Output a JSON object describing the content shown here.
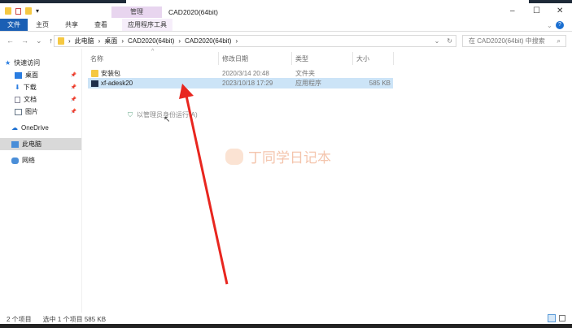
{
  "window": {
    "title": "CAD2020(64bit)",
    "context_tab": "管理",
    "minimize": "–",
    "maximize": "☐",
    "close": "✕"
  },
  "ribbon": {
    "tabs": [
      "文件",
      "主页",
      "共享",
      "查看",
      "应用程序工具"
    ]
  },
  "address": {
    "crumbs": [
      "此电脑",
      "桌面",
      "CAD2020(64bit)",
      "CAD2020(64bit)"
    ],
    "search_placeholder": "在 CAD2020(64bit) 中搜索"
  },
  "sidebar": {
    "items": [
      {
        "label": "快速访问"
      },
      {
        "label": "桌面"
      },
      {
        "label": "下载"
      },
      {
        "label": "文档"
      },
      {
        "label": "图片"
      },
      {
        "label": "OneDrive"
      },
      {
        "label": "此电脑"
      },
      {
        "label": "网络"
      }
    ]
  },
  "columns": {
    "name": "名称",
    "date": "修改日期",
    "type": "类型",
    "size": "大小"
  },
  "files": [
    {
      "name": "安装包",
      "date": "2020/3/14 20:48",
      "type": "文件夹",
      "size": ""
    },
    {
      "name": "xf-adesk20",
      "date": "2023/10/18 17:29",
      "type": "应用程序",
      "size": "585 KB"
    }
  ],
  "context_hint": "以管理员身份运行(A)",
  "watermark": "丁同学日记本",
  "status": {
    "count": "2 个项目",
    "selected": "选中 1 个项目",
    "size": "585 KB"
  },
  "colors": {
    "accent": "#1a5fb4",
    "selection": "#cce4f7",
    "arrow": "#e8261f"
  }
}
